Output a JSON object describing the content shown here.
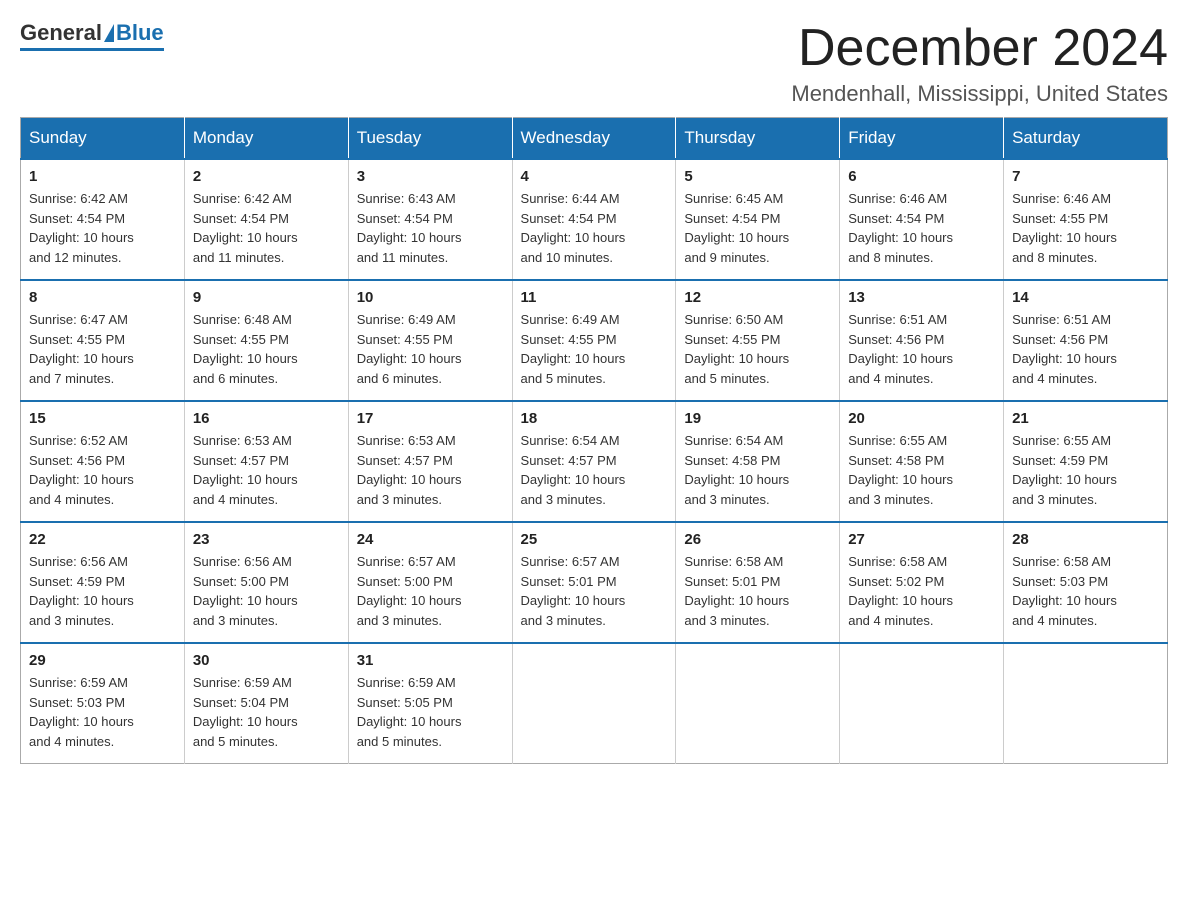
{
  "header": {
    "logo": {
      "general": "General",
      "blue": "Blue"
    },
    "title": "December 2024",
    "subtitle": "Mendenhall, Mississippi, United States"
  },
  "calendar": {
    "days_of_week": [
      "Sunday",
      "Monday",
      "Tuesday",
      "Wednesday",
      "Thursday",
      "Friday",
      "Saturday"
    ],
    "weeks": [
      [
        {
          "day": "1",
          "sunrise": "6:42 AM",
          "sunset": "4:54 PM",
          "daylight": "10 hours and 12 minutes."
        },
        {
          "day": "2",
          "sunrise": "6:42 AM",
          "sunset": "4:54 PM",
          "daylight": "10 hours and 11 minutes."
        },
        {
          "day": "3",
          "sunrise": "6:43 AM",
          "sunset": "4:54 PM",
          "daylight": "10 hours and 11 minutes."
        },
        {
          "day": "4",
          "sunrise": "6:44 AM",
          "sunset": "4:54 PM",
          "daylight": "10 hours and 10 minutes."
        },
        {
          "day": "5",
          "sunrise": "6:45 AM",
          "sunset": "4:54 PM",
          "daylight": "10 hours and 9 minutes."
        },
        {
          "day": "6",
          "sunrise": "6:46 AM",
          "sunset": "4:54 PM",
          "daylight": "10 hours and 8 minutes."
        },
        {
          "day": "7",
          "sunrise": "6:46 AM",
          "sunset": "4:55 PM",
          "daylight": "10 hours and 8 minutes."
        }
      ],
      [
        {
          "day": "8",
          "sunrise": "6:47 AM",
          "sunset": "4:55 PM",
          "daylight": "10 hours and 7 minutes."
        },
        {
          "day": "9",
          "sunrise": "6:48 AM",
          "sunset": "4:55 PM",
          "daylight": "10 hours and 6 minutes."
        },
        {
          "day": "10",
          "sunrise": "6:49 AM",
          "sunset": "4:55 PM",
          "daylight": "10 hours and 6 minutes."
        },
        {
          "day": "11",
          "sunrise": "6:49 AM",
          "sunset": "4:55 PM",
          "daylight": "10 hours and 5 minutes."
        },
        {
          "day": "12",
          "sunrise": "6:50 AM",
          "sunset": "4:55 PM",
          "daylight": "10 hours and 5 minutes."
        },
        {
          "day": "13",
          "sunrise": "6:51 AM",
          "sunset": "4:56 PM",
          "daylight": "10 hours and 4 minutes."
        },
        {
          "day": "14",
          "sunrise": "6:51 AM",
          "sunset": "4:56 PM",
          "daylight": "10 hours and 4 minutes."
        }
      ],
      [
        {
          "day": "15",
          "sunrise": "6:52 AM",
          "sunset": "4:56 PM",
          "daylight": "10 hours and 4 minutes."
        },
        {
          "day": "16",
          "sunrise": "6:53 AM",
          "sunset": "4:57 PM",
          "daylight": "10 hours and 4 minutes."
        },
        {
          "day": "17",
          "sunrise": "6:53 AM",
          "sunset": "4:57 PM",
          "daylight": "10 hours and 3 minutes."
        },
        {
          "day": "18",
          "sunrise": "6:54 AM",
          "sunset": "4:57 PM",
          "daylight": "10 hours and 3 minutes."
        },
        {
          "day": "19",
          "sunrise": "6:54 AM",
          "sunset": "4:58 PM",
          "daylight": "10 hours and 3 minutes."
        },
        {
          "day": "20",
          "sunrise": "6:55 AM",
          "sunset": "4:58 PM",
          "daylight": "10 hours and 3 minutes."
        },
        {
          "day": "21",
          "sunrise": "6:55 AM",
          "sunset": "4:59 PM",
          "daylight": "10 hours and 3 minutes."
        }
      ],
      [
        {
          "day": "22",
          "sunrise": "6:56 AM",
          "sunset": "4:59 PM",
          "daylight": "10 hours and 3 minutes."
        },
        {
          "day": "23",
          "sunrise": "6:56 AM",
          "sunset": "5:00 PM",
          "daylight": "10 hours and 3 minutes."
        },
        {
          "day": "24",
          "sunrise": "6:57 AM",
          "sunset": "5:00 PM",
          "daylight": "10 hours and 3 minutes."
        },
        {
          "day": "25",
          "sunrise": "6:57 AM",
          "sunset": "5:01 PM",
          "daylight": "10 hours and 3 minutes."
        },
        {
          "day": "26",
          "sunrise": "6:58 AM",
          "sunset": "5:01 PM",
          "daylight": "10 hours and 3 minutes."
        },
        {
          "day": "27",
          "sunrise": "6:58 AM",
          "sunset": "5:02 PM",
          "daylight": "10 hours and 4 minutes."
        },
        {
          "day": "28",
          "sunrise": "6:58 AM",
          "sunset": "5:03 PM",
          "daylight": "10 hours and 4 minutes."
        }
      ],
      [
        {
          "day": "29",
          "sunrise": "6:59 AM",
          "sunset": "5:03 PM",
          "daylight": "10 hours and 4 minutes."
        },
        {
          "day": "30",
          "sunrise": "6:59 AM",
          "sunset": "5:04 PM",
          "daylight": "10 hours and 5 minutes."
        },
        {
          "day": "31",
          "sunrise": "6:59 AM",
          "sunset": "5:05 PM",
          "daylight": "10 hours and 5 minutes."
        },
        null,
        null,
        null,
        null
      ]
    ],
    "labels": {
      "sunrise": "Sunrise:",
      "sunset": "Sunset:",
      "daylight": "Daylight:"
    }
  }
}
